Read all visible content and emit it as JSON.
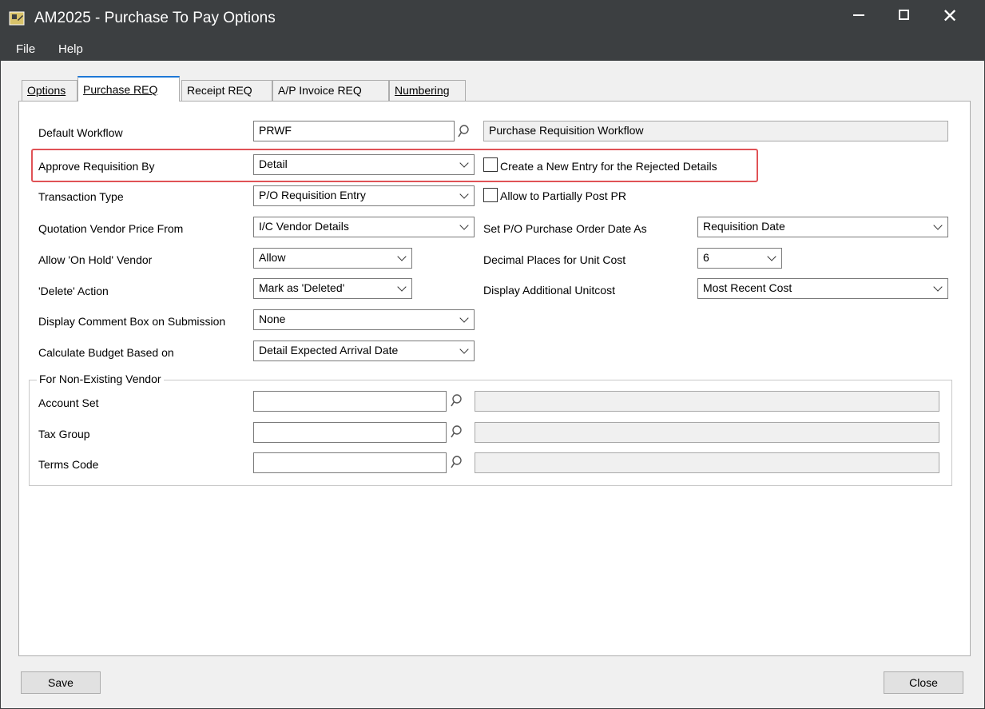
{
  "window": {
    "title": "AM2025 - Purchase To Pay Options",
    "minimize_label": "",
    "maximize_label": "",
    "close_label": "✕"
  },
  "menu": {
    "file": "File",
    "help": "Help"
  },
  "tabs": [
    {
      "label": "Options",
      "active": false
    },
    {
      "label": "Purchase REQ",
      "active": true
    },
    {
      "label": "Receipt REQ",
      "active": false
    },
    {
      "label": "A/P Invoice REQ",
      "active": false
    },
    {
      "label": "Numbering",
      "active": false
    }
  ],
  "form": {
    "default_workflow": {
      "label": "Default Workflow",
      "value": "PRWF",
      "description": "Purchase Requisition Workflow"
    },
    "approve_requisition_by": {
      "label": "Approve Requisition By",
      "value": "Detail"
    },
    "create_new_entry_rejected": {
      "label": "Create a New Entry for the Rejected Details",
      "checked": false
    },
    "transaction_type": {
      "label": "Transaction Type",
      "value": "P/O Requisition Entry"
    },
    "allow_partially_post": {
      "label": "Allow to Partially Post PR",
      "checked": false
    },
    "quotation_vendor_price_from": {
      "label": "Quotation Vendor Price From",
      "value": "I/C Vendor Details"
    },
    "set_po_date_as": {
      "label": "Set P/O Purchase Order Date As",
      "value": "Requisition Date"
    },
    "allow_on_hold_vendor": {
      "label": "Allow 'On Hold' Vendor",
      "value": "Allow"
    },
    "decimal_places_unit_cost": {
      "label": "Decimal Places for Unit Cost",
      "value": "6"
    },
    "delete_action": {
      "label": "'Delete' Action",
      "value": "Mark as 'Deleted'"
    },
    "display_additional_unitcost": {
      "label": "Display Additional Unitcost",
      "value": "Most Recent Cost"
    },
    "display_comment_box": {
      "label": "Display Comment Box on Submission",
      "value": "None"
    },
    "calculate_budget_based_on": {
      "label": "Calculate Budget Based on",
      "value": "Detail Expected Arrival Date"
    }
  },
  "non_existing_vendor": {
    "title": "For Non-Existing Vendor",
    "account_set": {
      "label": "Account Set",
      "value": "",
      "description": ""
    },
    "tax_group": {
      "label": "Tax Group",
      "value": "",
      "description": ""
    },
    "terms_code": {
      "label": "Terms Code",
      "value": "",
      "description": ""
    }
  },
  "buttons": {
    "save": "Save",
    "close": "Close"
  },
  "colors": {
    "titlebar": "#3c3f41",
    "highlight": "#e05256",
    "active_tab_accent": "#1e78d6"
  },
  "icons": {
    "lookup": "magnifier-icon",
    "dropdown": "chevron-down-icon"
  }
}
